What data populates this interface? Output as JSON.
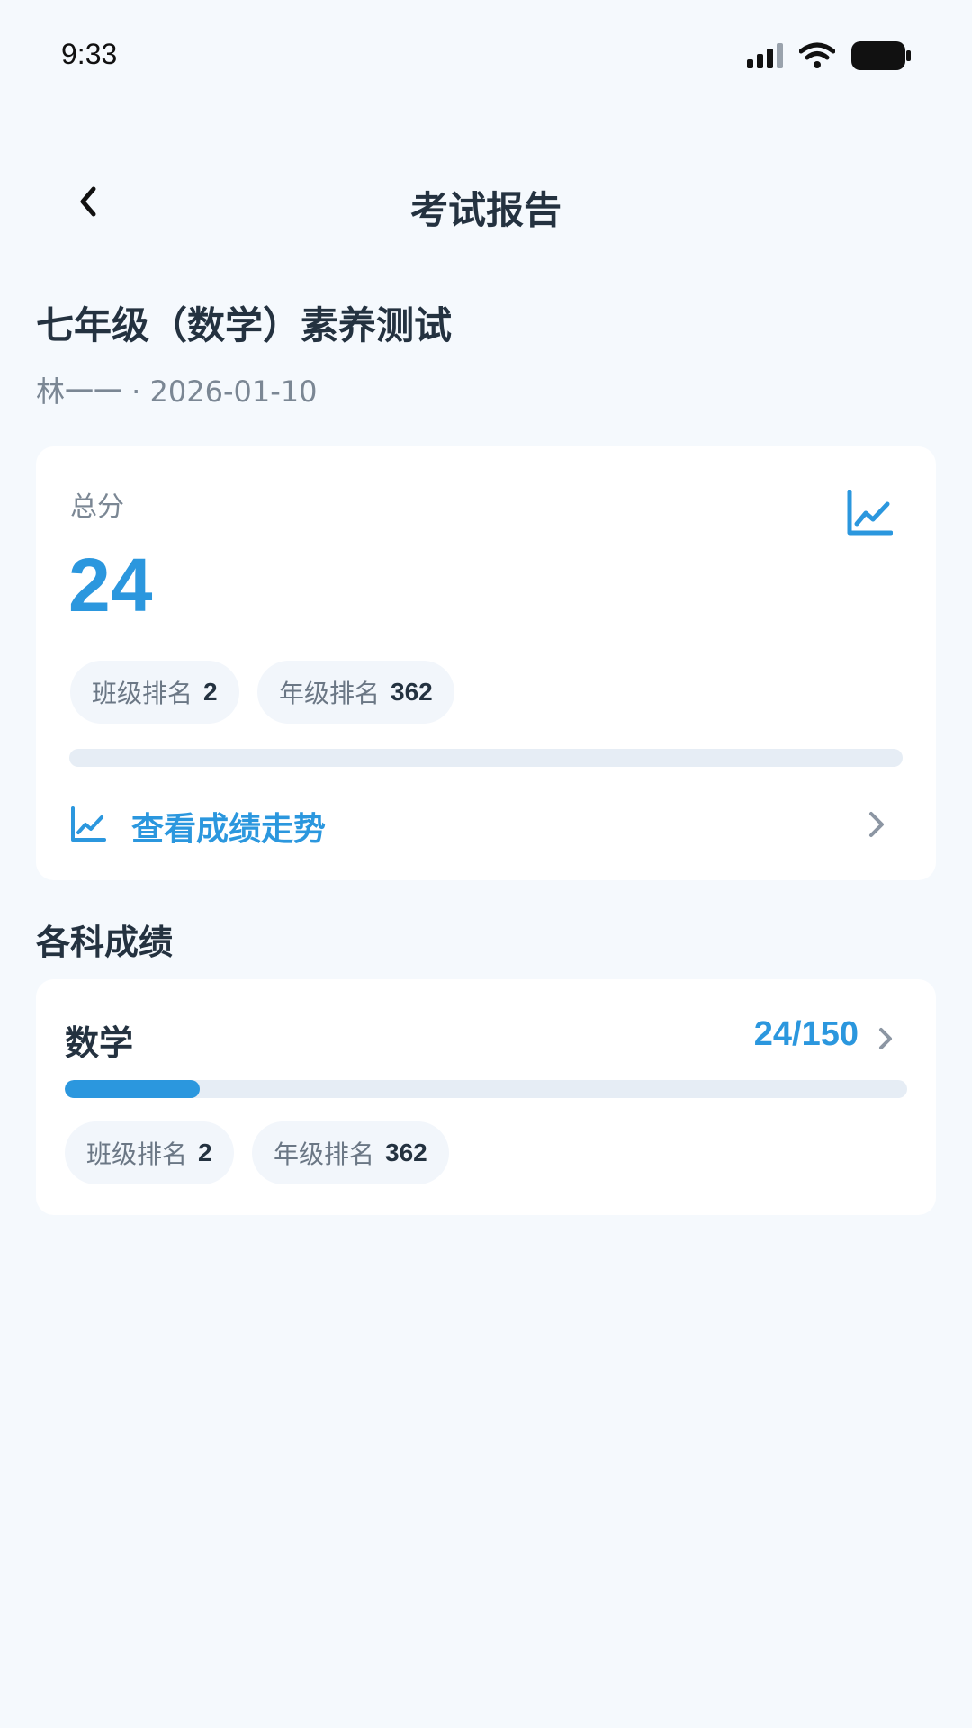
{
  "status_bar": {
    "time": "9:33",
    "icons": [
      "signal-icon",
      "wifi-icon",
      "battery-icon"
    ]
  },
  "nav": {
    "title": "考试报告",
    "back_icon": "chevron-left-icon"
  },
  "exam": {
    "title": "七年级（数学）素养测试",
    "meta": "林一一 · 2026-01-10"
  },
  "total_card": {
    "label": "总分",
    "score": "24",
    "class_rank_label": "班级排名",
    "class_rank_value": "2",
    "grade_rank_label": "年级排名",
    "grade_rank_value": "362",
    "progress_fraction": 0,
    "trend_link_label": "查看成绩走势",
    "trend_icon": "line-chart-icon"
  },
  "subjects_section": {
    "title": "各科成绩",
    "items": [
      {
        "name": "数学",
        "score_text": "24/150",
        "progress_fraction": 0.16,
        "class_rank_label": "班级排名",
        "class_rank_value": "2",
        "grade_rank_label": "年级排名",
        "grade_rank_value": "362"
      }
    ]
  },
  "colors": {
    "accent": "#2b97de",
    "background": "#f5f9fd",
    "card": "#ffffff",
    "chip": "#f2f6fb",
    "track": "#e6edf5"
  }
}
